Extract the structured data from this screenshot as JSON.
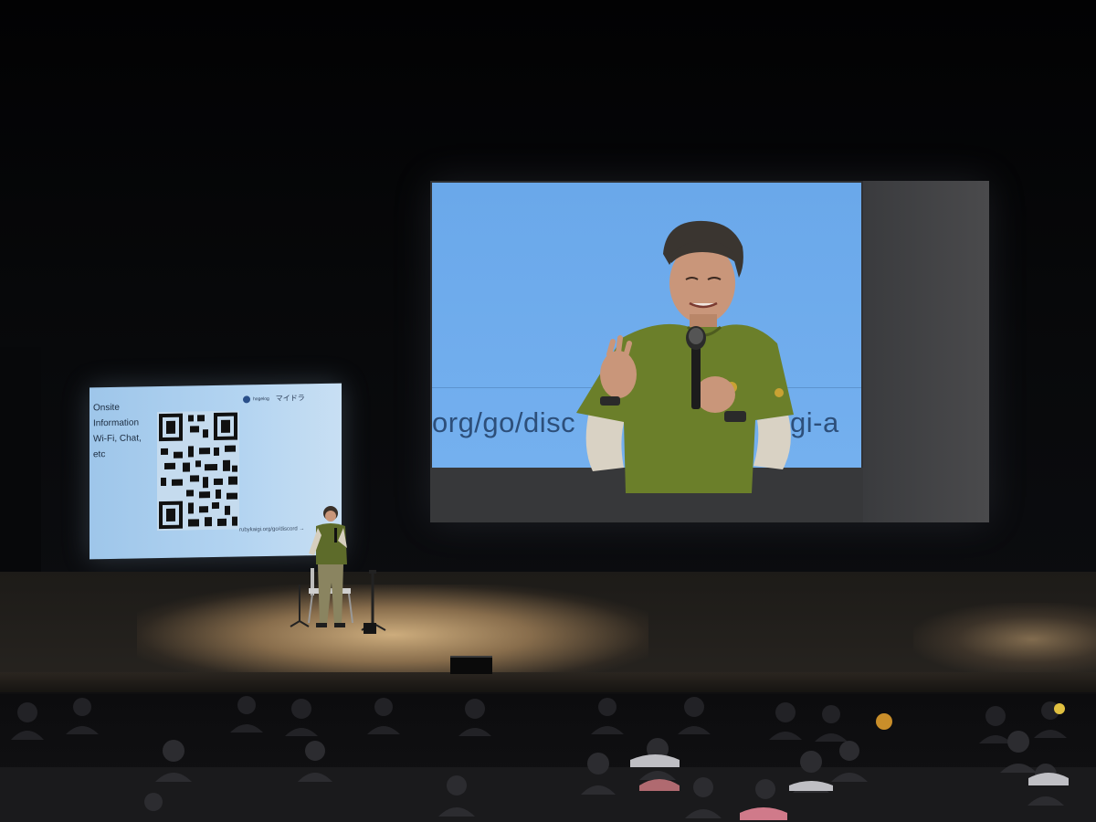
{
  "side_screen": {
    "info_lines": [
      "Onsite",
      "Information",
      "Wi-Fi, Chat,",
      "etc"
    ],
    "logo_text": "hogelog",
    "logo_jp": "マイドラ",
    "url": "rubykaigi.org/go/discord →"
  },
  "main_screen": {
    "video_text_left": "org/go/disc",
    "video_text_right": "gi-a"
  },
  "colors": {
    "screen_blue": "#6aa8ea",
    "shirt_green": "#6b7f2a",
    "stage_light": "#d6b482"
  }
}
